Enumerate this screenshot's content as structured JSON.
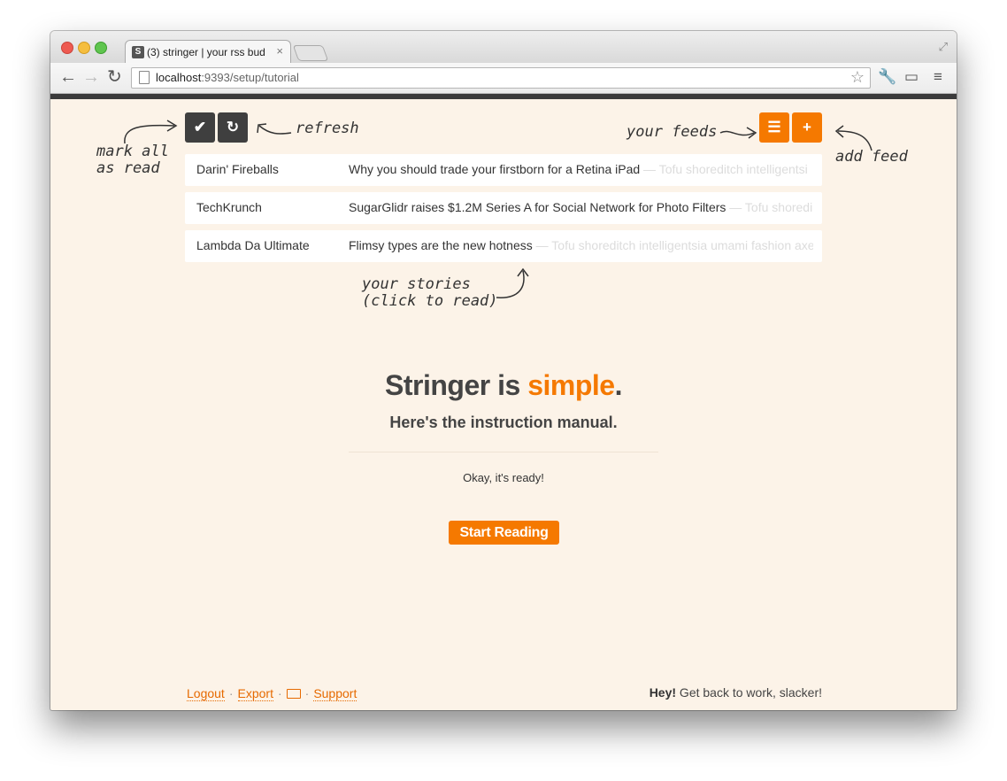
{
  "browser": {
    "tab_title": "(3) stringer | your rss bud",
    "tab_favicon": "S",
    "tab_close": "×",
    "url_host": "localhost",
    "url_rest": ":9393/setup/tutorial"
  },
  "annotations": {
    "mark_all": "mark all\nas read",
    "refresh": "refresh",
    "your_feeds": "your feeds",
    "add_feed": "add feed",
    "your_stories": "your stories\n(click to read)"
  },
  "stories": [
    {
      "source": "Darin' Fireballs",
      "headline": "Why you should trade your firstborn for a Retina iPad",
      "lead": " — Tofu shoreditch intelligentsi"
    },
    {
      "source": "TechKrunch",
      "headline": "SugarGlidr raises $1.2M Series A for Social Network for Photo Filters",
      "lead": " — Tofu shoredi"
    },
    {
      "source": "Lambda Da Ultimate",
      "headline": "Flimsy types are the new hotness",
      "lead": " — Tofu shoreditch intelligentsia umami  fashion axe"
    }
  ],
  "main": {
    "title_prefix": "Stringer is ",
    "title_accent": "simple",
    "title_suffix": ".",
    "subtitle": "Here's the instruction manual.",
    "status": "Okay, it's ready!",
    "start_button": "Start Reading"
  },
  "footer": {
    "logout": "Logout",
    "export": "Export",
    "support": "Support",
    "separator": "·",
    "greeting_bold": "Hey!",
    "greeting_rest": " Get back to work, slacker!"
  },
  "colors": {
    "accent": "#f57900",
    "dark_button": "#3f3f3f",
    "background": "#fcf3e8"
  },
  "icons": {
    "mark_all_button": "check-icon",
    "refresh_button": "refresh-icon",
    "feeds_button": "list-icon",
    "add_feed_button": "plus-icon",
    "keyboard": "keyboard-icon"
  }
}
